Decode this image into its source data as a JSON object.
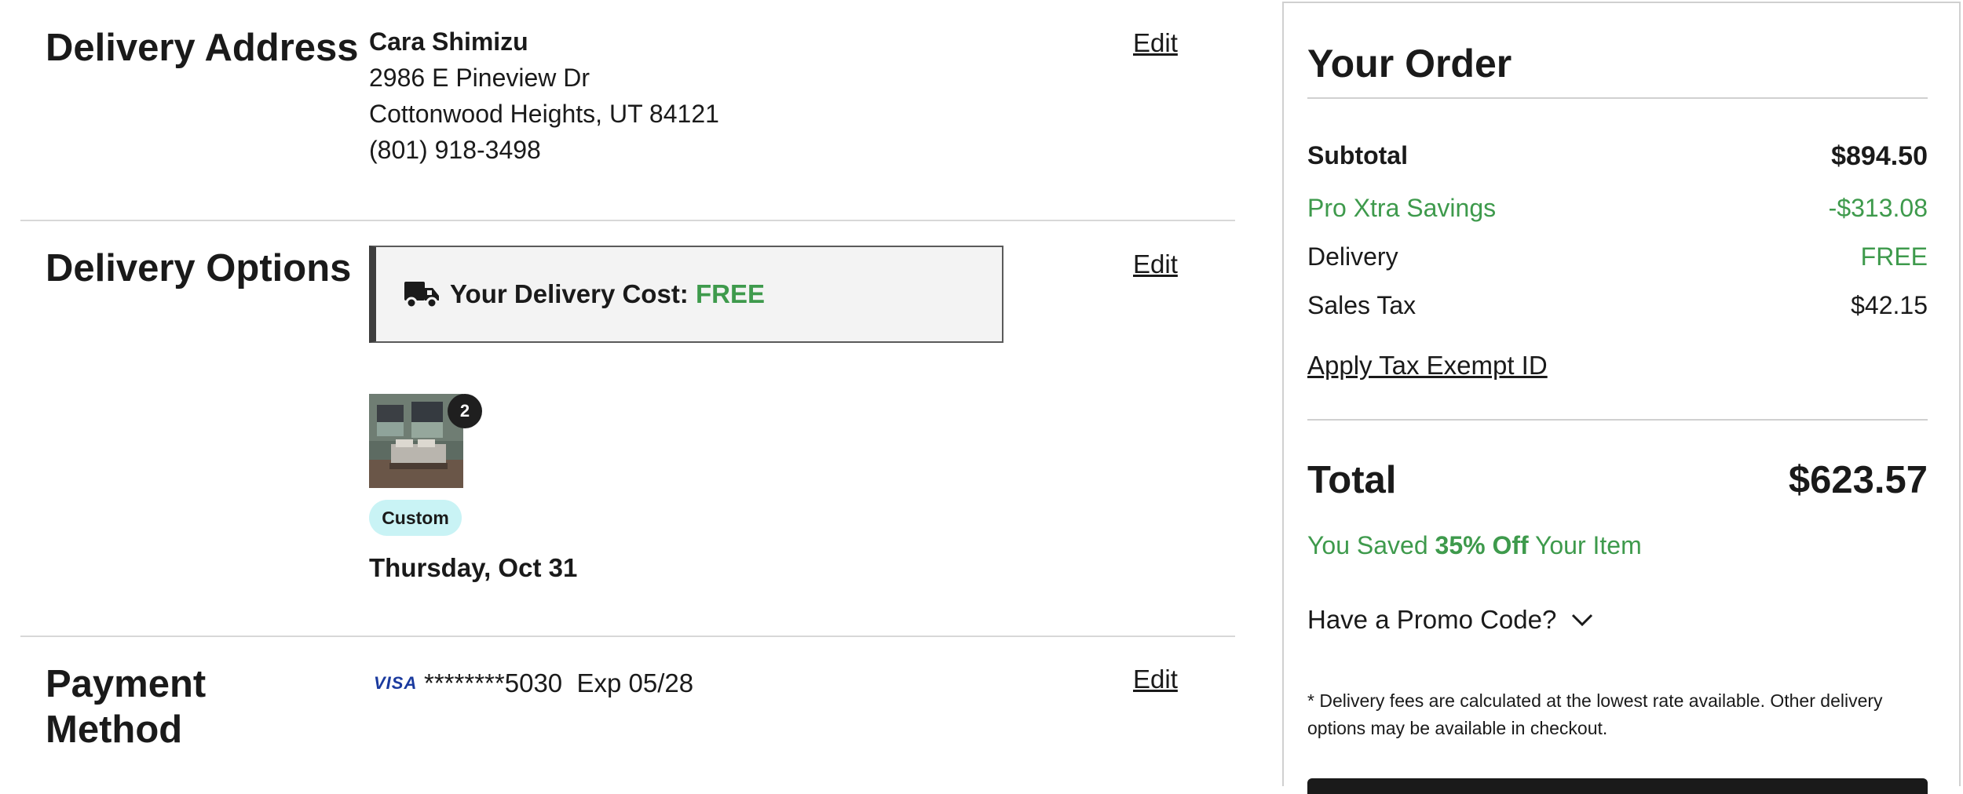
{
  "delivery_address": {
    "title": "Delivery Address",
    "edit_label": "Edit",
    "name": "Cara Shimizu",
    "street": "2986 E Pineview Dr",
    "city_line": "Cottonwood Heights, UT 84121",
    "phone": "(801) 918-3498"
  },
  "delivery_options": {
    "title": "Delivery Options",
    "edit_label": "Edit",
    "cost_label": "Your Delivery Cost:",
    "cost_value": "FREE",
    "quantity_badge": "2",
    "custom_tag": "Custom",
    "delivery_date": "Thursday, Oct 31",
    "truck_icon": "truck-icon"
  },
  "payment": {
    "title_line1": "Payment",
    "title_line2": "Method",
    "edit_label": "Edit",
    "card_brand": "VISA",
    "card_number": "********5030",
    "expiry": "Exp 05/28"
  },
  "order": {
    "title": "Your Order",
    "subtotal_label": "Subtotal",
    "subtotal_value": "$894.50",
    "savings_label": "Pro Xtra Savings",
    "savings_value": "-$313.08",
    "delivery_label": "Delivery",
    "delivery_value": "FREE",
    "tax_label": "Sales Tax",
    "tax_value": "$42.15",
    "tax_exempt_link": "Apply Tax Exempt ID",
    "total_label": "Total",
    "total_value": "$623.57",
    "saved_prefix": "You Saved",
    "saved_percent": "35% Off",
    "saved_suffix": "Your Item",
    "promo_label": "Have a Promo Code?",
    "note": "* Delivery fees are calculated at the lowest rate available. Other delivery options may be available in checkout."
  },
  "colors": {
    "accent_green": "#3e9a4c",
    "custom_tag_bg": "#c9f3f5",
    "visa_blue": "#1a3a9e"
  }
}
